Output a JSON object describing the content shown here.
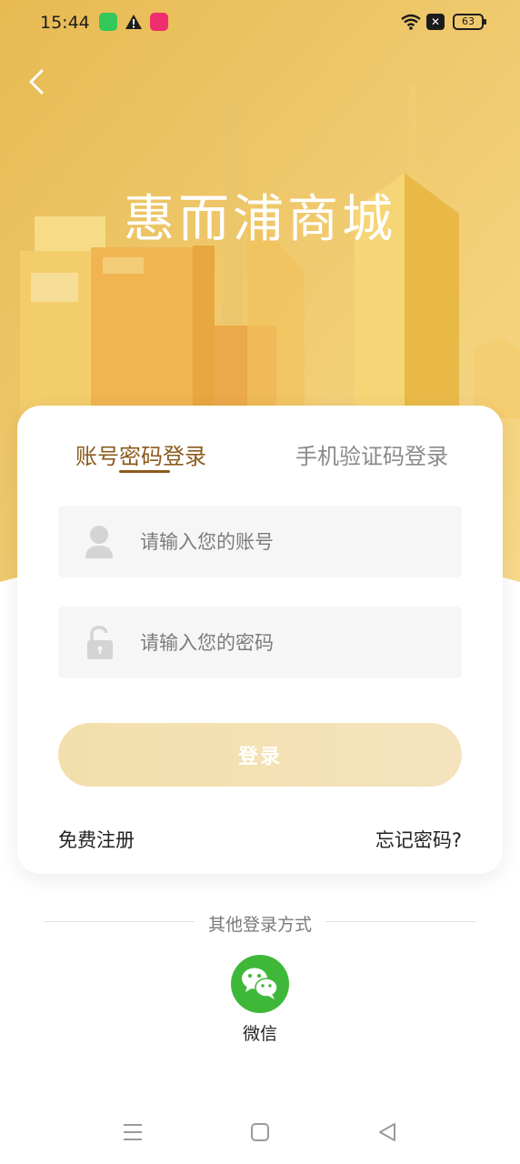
{
  "status_bar": {
    "time": "15:44",
    "battery": "63"
  },
  "header": {
    "app_title": "惠而浦商城",
    "colors": {
      "gradient_start": "#e6b84e",
      "gradient_end": "#f7d98a"
    }
  },
  "login_card": {
    "tabs": [
      {
        "label": "账号密码登录",
        "active": true
      },
      {
        "label": "手机验证码登录",
        "active": false
      }
    ],
    "account_field": {
      "placeholder": "请输入您的账号",
      "value": "",
      "icon": "user-icon"
    },
    "password_field": {
      "placeholder": "请输入您的密码",
      "value": "",
      "icon": "lock-icon"
    },
    "login_button": "登录",
    "register_link": "免费注册",
    "forgot_link": "忘记密码?"
  },
  "other_login": {
    "label": "其他登录方式",
    "wechat_label": "微信"
  },
  "accent_color": "#8b5a1c"
}
